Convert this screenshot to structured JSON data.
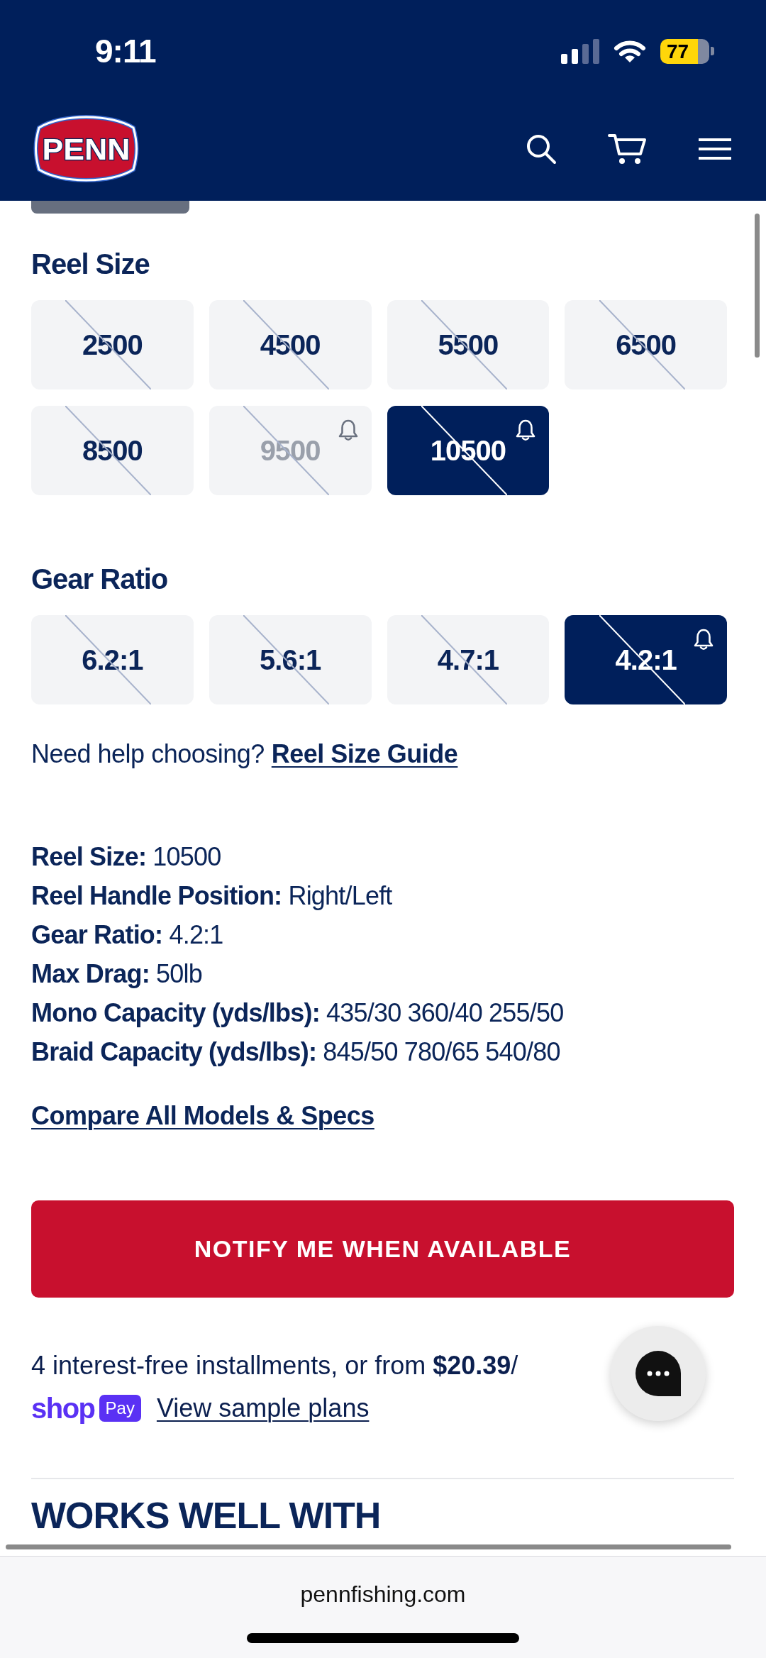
{
  "status_bar": {
    "time": "9:11",
    "battery": "77"
  },
  "header": {
    "logo": "PENN"
  },
  "reel_size": {
    "title": "Reel Size",
    "options": [
      {
        "label": "2500",
        "selected": false,
        "disabled": false,
        "unavailable": true,
        "alert": false
      },
      {
        "label": "4500",
        "selected": false,
        "disabled": false,
        "unavailable": true,
        "alert": false
      },
      {
        "label": "5500",
        "selected": false,
        "disabled": false,
        "unavailable": true,
        "alert": false
      },
      {
        "label": "6500",
        "selected": false,
        "disabled": false,
        "unavailable": true,
        "alert": false
      },
      {
        "label": "8500",
        "selected": false,
        "disabled": false,
        "unavailable": true,
        "alert": false
      },
      {
        "label": "9500",
        "selected": false,
        "disabled": true,
        "unavailable": true,
        "alert": true
      },
      {
        "label": "10500",
        "selected": true,
        "disabled": false,
        "unavailable": true,
        "alert": true
      }
    ]
  },
  "gear_ratio": {
    "title": "Gear Ratio",
    "options": [
      {
        "label": "6.2:1",
        "selected": false,
        "disabled": false,
        "unavailable": true,
        "alert": false
      },
      {
        "label": "5.6:1",
        "selected": false,
        "disabled": false,
        "unavailable": true,
        "alert": false
      },
      {
        "label": "4.7:1",
        "selected": false,
        "disabled": false,
        "unavailable": true,
        "alert": false
      },
      {
        "label": "4.2:1",
        "selected": true,
        "disabled": false,
        "unavailable": true,
        "alert": true
      }
    ]
  },
  "help": {
    "prompt": "Need help choosing?",
    "link": "Reel Size Guide"
  },
  "specs": [
    {
      "label": "Reel Size:",
      "value": "10500"
    },
    {
      "label": "Reel Handle Position:",
      "value": "Right/Left"
    },
    {
      "label": "Gear Ratio:",
      "value": "4.2:1"
    },
    {
      "label": "Max Drag:",
      "value": "50lb"
    },
    {
      "label": "Mono Capacity (yds/lbs):",
      "value": "435/30 360/40 255/50"
    },
    {
      "label": "Braid Capacity (yds/lbs):",
      "value": "845/50 780/65 540/80"
    }
  ],
  "compare_link": "Compare All Models & Specs",
  "notify_button": "NOTIFY ME WHEN AVAILABLE",
  "installments": {
    "text": "4 interest-free installments, or from **$20.39**/",
    "logo_word": "shop",
    "logo_badge": "Pay",
    "link": "View sample plans"
  },
  "next_section": {
    "title": "WORKS WELL WITH"
  },
  "browser_bar": {
    "address": "pennfishing.com"
  }
}
